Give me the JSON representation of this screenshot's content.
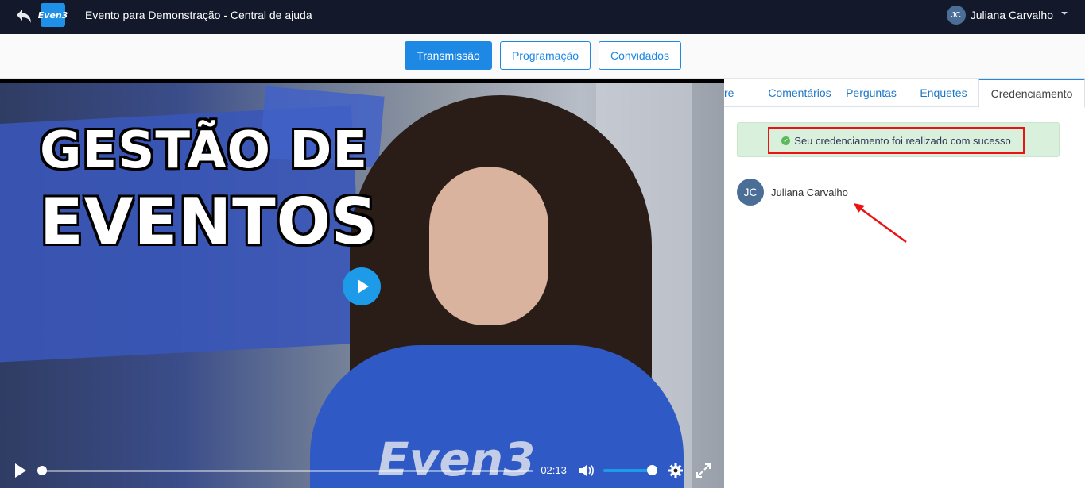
{
  "header": {
    "logo_text": "Even3",
    "title": "Evento para Demonstração - Central de ajuda",
    "user_initials": "JC",
    "user_name": "Juliana Carvalho"
  },
  "tabs": [
    {
      "label": "Transmissão",
      "active": true
    },
    {
      "label": "Programação",
      "active": false
    },
    {
      "label": "Convidados",
      "active": false
    }
  ],
  "video": {
    "headline_line1": "GESTÃO DE",
    "headline_line2": "EVENTOS",
    "shirt_logo": "Even3",
    "time_remaining": "-02:13",
    "progress": 0,
    "volume": 1.0
  },
  "side_panel": {
    "tabs": [
      {
        "label": "re",
        "active": false
      },
      {
        "label": "Comentários",
        "active": false
      },
      {
        "label": "Perguntas",
        "active": false
      },
      {
        "label": "Enquetes",
        "active": false
      },
      {
        "label": "Credenciamento",
        "active": true
      }
    ],
    "alert_text": "Seu credenciamento foi realizado com sucesso",
    "user_initials": "JC",
    "user_name": "Juliana Carvalho"
  },
  "colors": {
    "topbar_bg": "#13182b",
    "accent": "#1e88e5",
    "alert_bg": "#d8f0dc",
    "highlight": "#e11111"
  },
  "icons": [
    "back-arrow-icon",
    "caret-down-icon",
    "play-icon",
    "volume-icon",
    "gear-icon",
    "fullscreen-icon",
    "check-circle-icon"
  ]
}
